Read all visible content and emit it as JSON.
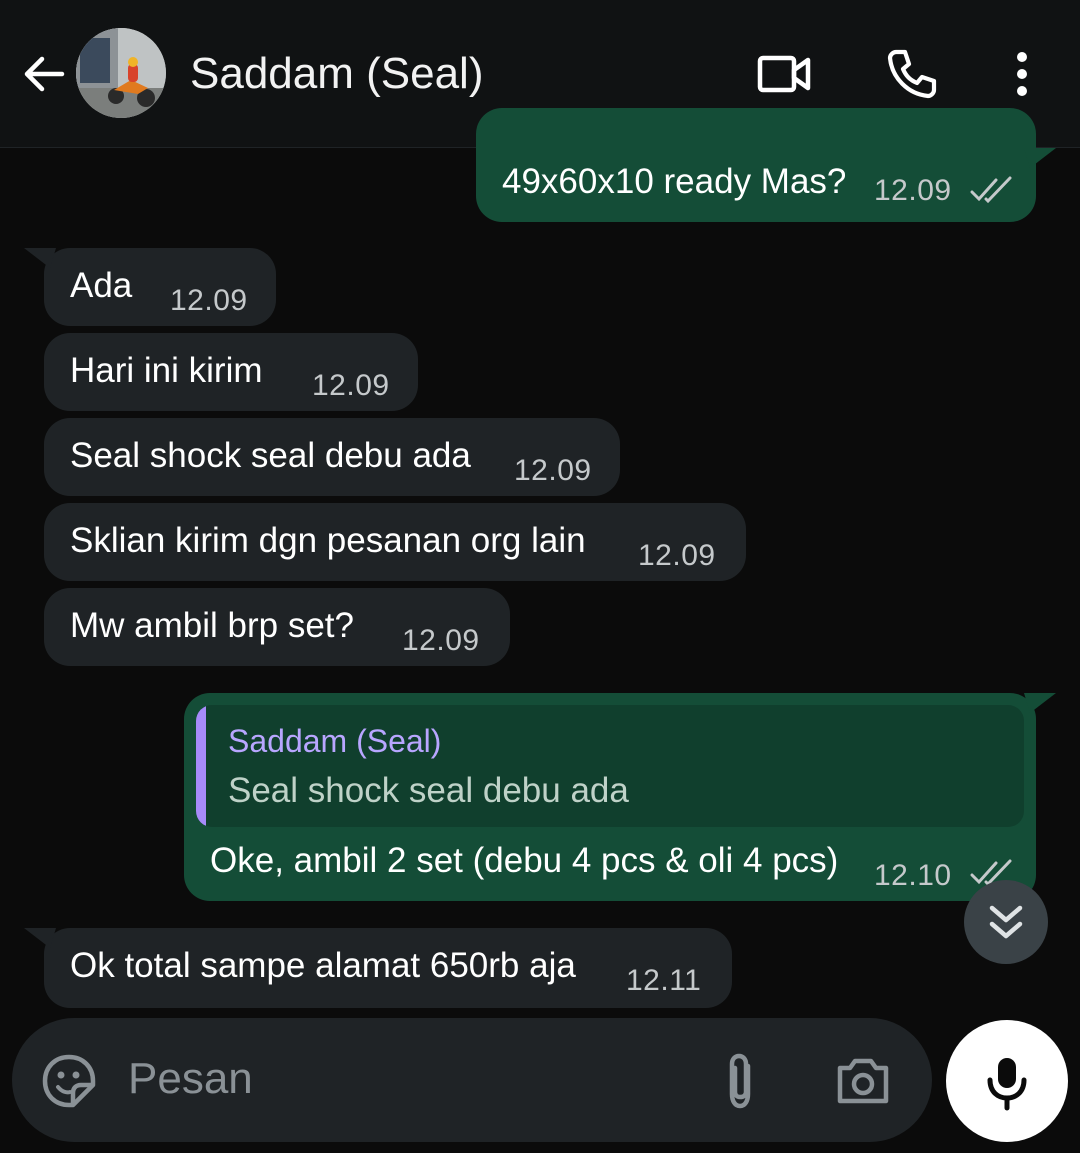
{
  "header": {
    "contact_name": "Saddam (Seal)",
    "icons": [
      "back-arrow-icon",
      "contact-avatar",
      "video-call-icon",
      "voice-call-icon",
      "more-vert-icon"
    ]
  },
  "messages": [
    {
      "direction": "out",
      "text": "49x60x10 ready Mas?",
      "time": "12.09",
      "status": "read"
    },
    {
      "direction": "in",
      "text": "Ada",
      "time": "12.09"
    },
    {
      "direction": "in",
      "text": "Hari ini kirim",
      "time": "12.09"
    },
    {
      "direction": "in",
      "text": "Seal shock seal debu ada",
      "time": "12.09"
    },
    {
      "direction": "in",
      "text": "Sklian kirim dgn pesanan org lain",
      "time": "12.09"
    },
    {
      "direction": "in",
      "text": "Mw ambil brp set?",
      "time": "12.09"
    },
    {
      "direction": "out",
      "quote_name": "Saddam (Seal)",
      "quote_text": "Seal shock seal debu ada",
      "text": "Oke, ambil 2 set (debu 4 pcs & oli 4 pcs)",
      "time": "12.10",
      "status": "read"
    },
    {
      "direction": "in",
      "text": "Ok total sampe alamat 650rb aja",
      "time": "12.11"
    }
  ],
  "input": {
    "placeholder": "Pesan",
    "icons": [
      "sticker-icon",
      "attach-icon",
      "camera-icon",
      "mic-icon"
    ]
  },
  "colors": {
    "background": "#0b0b0b",
    "header": "#101213",
    "incoming_bubble": "#1f2326",
    "outgoing_bubble": "#144d37",
    "quote_accent": "#a78bfa"
  }
}
